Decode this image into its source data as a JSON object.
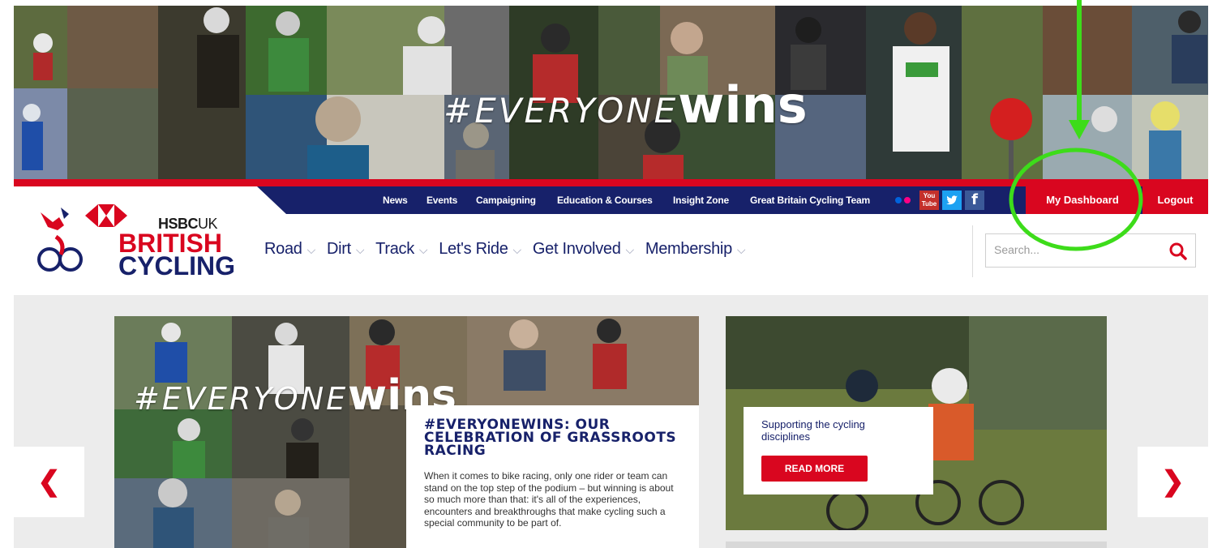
{
  "hero": {
    "tag_prefix": "#EVERYONE",
    "tag_suffix": "wins",
    "stop_sign": "STOP"
  },
  "utility_nav": {
    "links": [
      "News",
      "Events",
      "Campaigning",
      "Education & Courses",
      "Insight Zone",
      "Great Britain Cycling Team"
    ],
    "social_icons": [
      "flickr-icon",
      "youtube-icon",
      "twitter-icon",
      "facebook-icon"
    ],
    "youtube_label": "You Tube",
    "facebook_label": "f",
    "dashboard_label": "My Dashboard",
    "logout_label": "Logout"
  },
  "logo": {
    "sponsor": "HSBC",
    "sponsor_suffix": "UK",
    "line1": "BRITISH",
    "line2": "CYCLING"
  },
  "main_nav": {
    "items": [
      "Road",
      "Dirt",
      "Track",
      "Let's Ride",
      "Get Involved",
      "Membership"
    ]
  },
  "search": {
    "placeholder": "Search..."
  },
  "carousel": {
    "prev_label": "❮",
    "next_label": "❯",
    "feature": {
      "tag_prefix": "#EVERYONE",
      "tag_suffix": "wins",
      "title": "#EVERYONEWINS: OUR CELEBRATION OF GRASSROOTS RACING",
      "body": "When it comes to bike racing, only one rider or team can stand on the top step of the podium – but winning is about so much more than that: it's all of the experiences, encounters and breakthroughs that make cycling such a special community to be part of."
    },
    "secondary": {
      "title": "Supporting the cycling disciplines",
      "button_label": "READ MORE"
    }
  },
  "colors": {
    "brand_red": "#d9061f",
    "brand_navy": "#17216a",
    "annotation_green": "#3ddc1a"
  }
}
